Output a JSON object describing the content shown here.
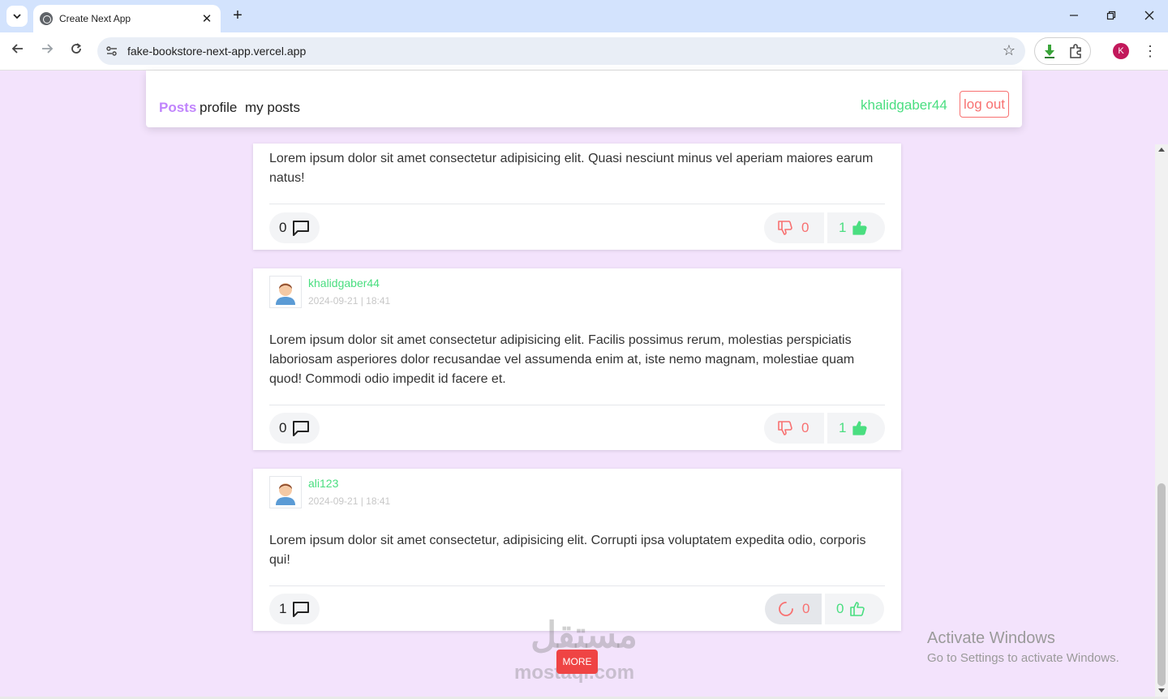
{
  "browser": {
    "tab_title": "Create Next App",
    "url": "fake-bookstore-next-app.vercel.app",
    "profile_initial": "K"
  },
  "header": {
    "nav": [
      {
        "label": "Posts",
        "active": true
      },
      {
        "label": "profile",
        "active": false
      },
      {
        "label": "my posts",
        "active": false
      }
    ],
    "username": "khalidgaber44",
    "logout_label": "log out"
  },
  "posts": [
    {
      "user": "",
      "date": "",
      "body": "Lorem ipsum dolor sit amet consectetur adipisicing elit. Quasi nesciunt minus vel aperiam maiores earum natus!",
      "comments": "0",
      "dislikes": "0",
      "likes": "1",
      "liked": true,
      "loading": false
    },
    {
      "user": "khalidgaber44",
      "date": "2024-09-21 | 18:41",
      "body": "Lorem ipsum dolor sit amet consectetur adipisicing elit. Facilis possimus rerum, molestias perspiciatis laboriosam asperiores dolor recusandae vel assumenda enim at, iste nemo magnam, molestiae quam quod! Commodi odio impedit id facere et.",
      "comments": "0",
      "dislikes": "0",
      "likes": "1",
      "liked": true,
      "loading": false
    },
    {
      "user": "ali123",
      "date": "2024-09-21 | 18:41",
      "body": "Lorem ipsum dolor sit amet consectetur, adipisicing elit. Corrupti ipsa voluptatem expedita odio, corporis qui!",
      "comments": "1",
      "dislikes": "0",
      "likes": "0",
      "liked": false,
      "loading": true
    }
  ],
  "more_label": "MORE",
  "watermark": {
    "arabic": "مستقل",
    "latin": "mostaql.com"
  },
  "os_overlay": {
    "title": "Activate Windows",
    "subtitle": "Go to Settings to activate Windows."
  },
  "colors": {
    "page_bg": "#f3e3fc",
    "accent_purple": "#c084fc",
    "green": "#4ade80",
    "red": "#f87171"
  }
}
